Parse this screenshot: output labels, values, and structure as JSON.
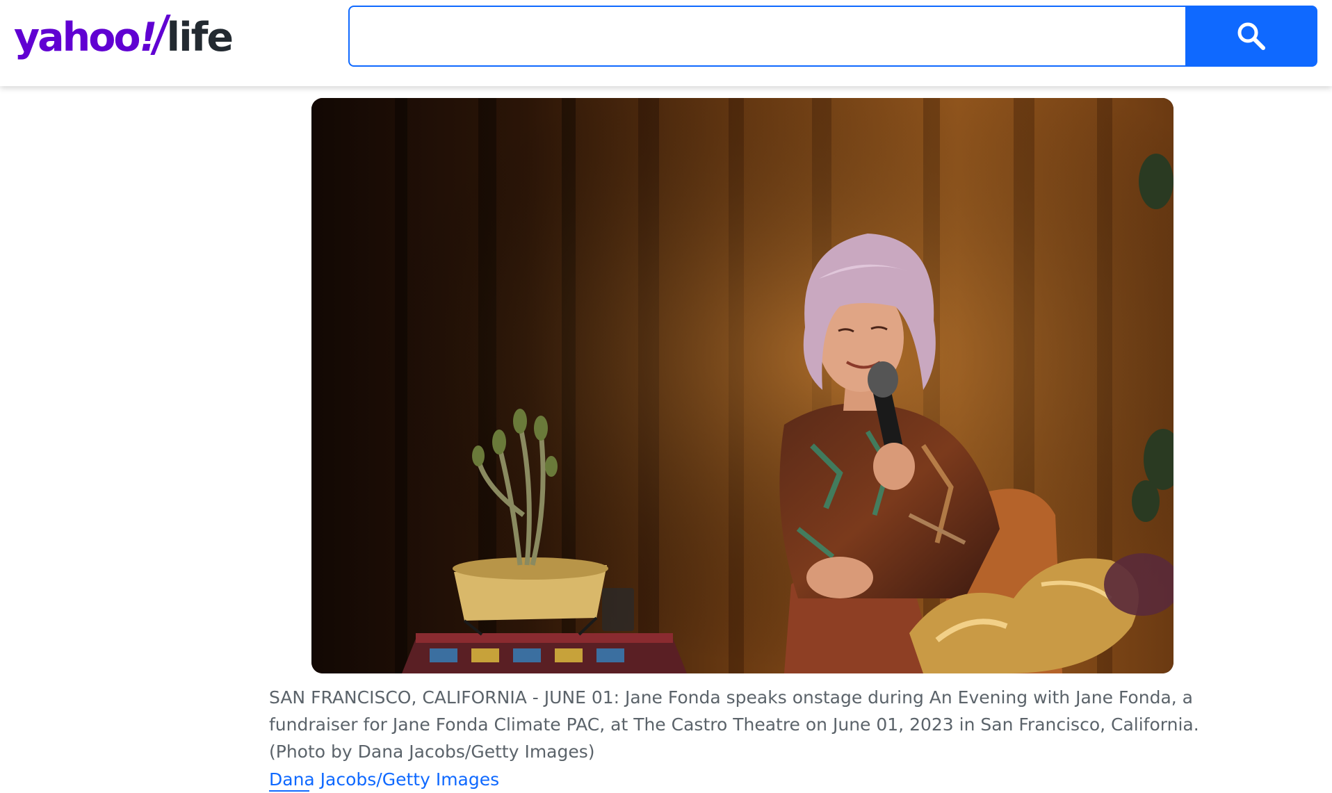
{
  "header": {
    "logo": {
      "yahoo_text": "yahoo",
      "bang_text": "!",
      "section_text": "life"
    },
    "search": {
      "value": "",
      "placeholder": "",
      "button_icon": "search-icon"
    }
  },
  "article": {
    "photo": {
      "alt": "SAN FRANCISCO, CALIFORNIA - JUNE 01: Jane Fonda speaks onstage during An Evening with Jane Fonda, a fundraiser for Jane Fonda Climate PAC, at The Castro Theatre on June 01, 2023 in San Francisco, California. (Photo by Dana Jacobs/Getty Images)"
    },
    "caption": "SAN FRANCISCO, CALIFORNIA - JUNE 01: Jane Fonda speaks onstage during An Evening with Jane Fonda, a fundraiser for Jane Fonda Climate PAC, at The Castro Theatre on June 01, 2023 in San Francisco, California. (Photo by Dana Jacobs/Getty Images)",
    "credit": "Dana Jacobs/Getty Images"
  },
  "colors": {
    "brand_purple": "#6001d2",
    "search_blue": "#0f69ff",
    "caption_gray": "#5b636a",
    "logo_dark": "#232a31"
  }
}
